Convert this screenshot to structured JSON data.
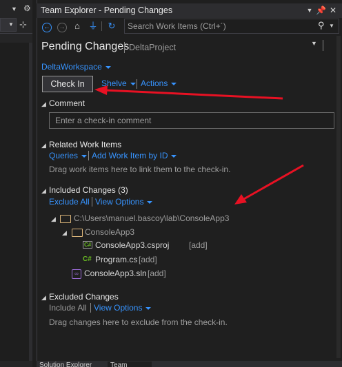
{
  "window": {
    "title": "Team Explorer - Pending Changes"
  },
  "toolbar": {
    "search_placeholder": "Search Work Items (Ctrl+´)"
  },
  "header": {
    "title": "Pending Changes",
    "project": "DeltaProject"
  },
  "workspace": {
    "label": "DeltaWorkspace"
  },
  "actions_bar": {
    "checkin_label": "Check In",
    "shelve_label": "Shelve",
    "actions_label": "Actions"
  },
  "comment": {
    "heading": "Comment",
    "placeholder": "Enter a check-in comment"
  },
  "related": {
    "heading": "Related Work Items",
    "queries_label": "Queries",
    "add_label": "Add Work Item by ID",
    "hint": "Drag work items here to link them to the check-in."
  },
  "included": {
    "heading": "Included Changes (3)",
    "exclude_all_label": "Exclude All",
    "view_options_label": "View Options",
    "root_path": "C:\\Users\\manuel.bascoy\\lab\\ConsoleApp3",
    "subfolder": "ConsoleApp3",
    "files": [
      {
        "icon": "C#",
        "name": "ConsoleApp3.csproj",
        "tag": "[add]"
      },
      {
        "icon": "C#",
        "name": "Program.cs",
        "tag": "[add]"
      },
      {
        "icon": "sln",
        "name": "ConsoleApp3.sln",
        "tag": "[add]"
      }
    ]
  },
  "excluded": {
    "heading": "Excluded Changes",
    "include_all_label": "Include All",
    "view_options_label": "View Options",
    "hint": "Drag changes here to exclude from the check-in."
  },
  "bottom_tabs": [
    {
      "label": "Solution Explorer"
    },
    {
      "label": "Team Explorer"
    }
  ],
  "colors": {
    "accent_link": "#3794ff",
    "annotation_arrow": "#e81123",
    "background": "#1f1f1f"
  }
}
